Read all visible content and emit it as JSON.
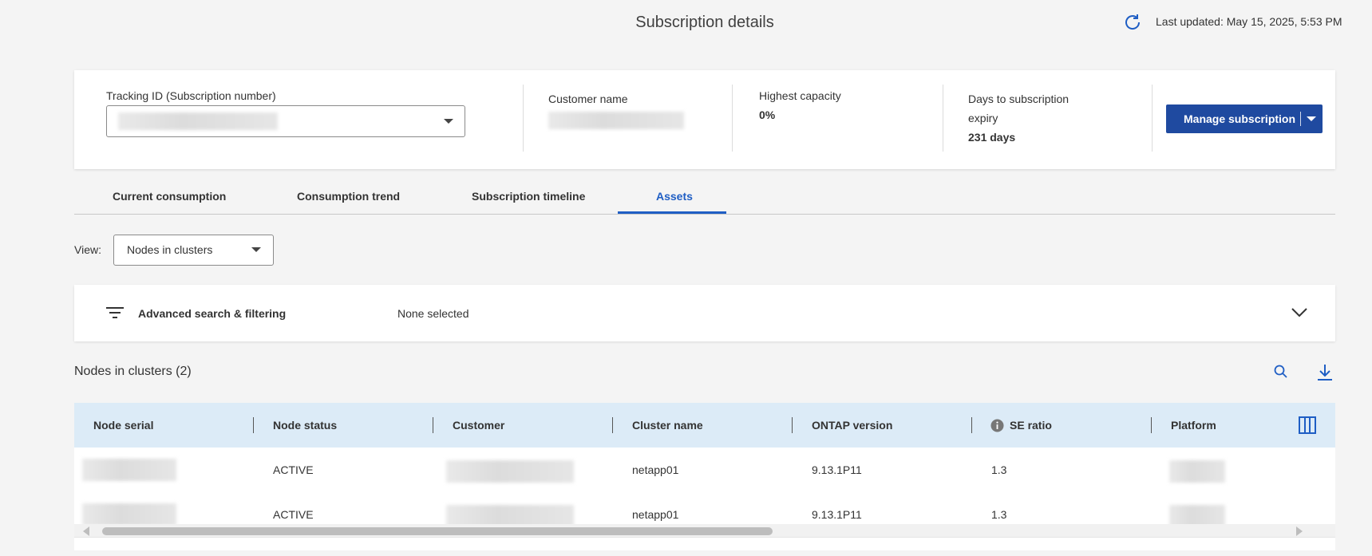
{
  "header": {
    "title": "Subscription details",
    "last_updated": "Last updated: May 15, 2025, 5:53 PM",
    "refresh_icon": "refresh-icon"
  },
  "summary": {
    "tracking_label": "Tracking ID (Subscription number)",
    "customer_label": "Customer name",
    "capacity_label": "Highest capacity",
    "capacity_value": "0%",
    "expiry_label_line1": "Days to subscription",
    "expiry_label_line2": "expiry",
    "expiry_value": "231 days",
    "manage_button": "Manage subscription"
  },
  "tabs": [
    {
      "label": "Current consumption",
      "active": false
    },
    {
      "label": "Consumption trend",
      "active": false
    },
    {
      "label": "Subscription timeline",
      "active": false
    },
    {
      "label": "Assets",
      "active": true
    }
  ],
  "view": {
    "label": "View:",
    "selected": "Nodes in clusters"
  },
  "filter": {
    "label": "Advanced search & filtering",
    "status": "None selected"
  },
  "table": {
    "title": "Nodes in clusters (2)",
    "columns": [
      "Node serial",
      "Node status",
      "Customer",
      "Cluster name",
      "ONTAP version",
      "SE ratio",
      "Platform"
    ],
    "rows": [
      {
        "status": "ACTIVE",
        "cluster": "netapp01",
        "ontap": "9.13.1P11",
        "se_ratio": "1.3"
      },
      {
        "status": "ACTIVE",
        "cluster": "netapp01",
        "ontap": "9.13.1P11",
        "se_ratio": "1.3"
      }
    ]
  },
  "colors": {
    "accent": "#1f5ec4",
    "button": "#1f4aa0",
    "table_header": "#dcebf7",
    "background": "#f4f4f4"
  }
}
